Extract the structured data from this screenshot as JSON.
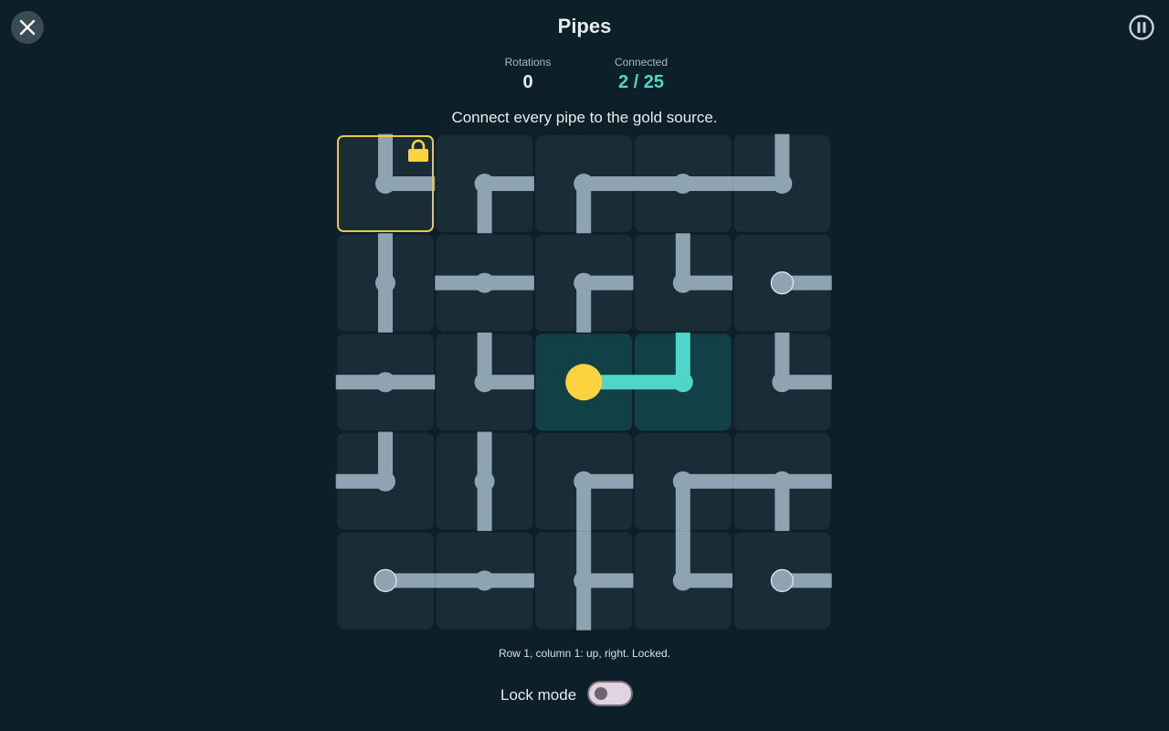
{
  "header": {
    "title": "Pipes",
    "close_icon": "close-icon",
    "pause_icon": "pause-icon"
  },
  "stats": {
    "rotations_label": "Rotations",
    "rotations_value": "0",
    "connected_label": "Connected",
    "connected_value": "2 / 25"
  },
  "instruction": "Connect every pipe to the gold source.",
  "grid": {
    "rows": 5,
    "cols": 5,
    "source": [
      2,
      2
    ],
    "selected": [
      0,
      0
    ],
    "locked": [
      [
        0,
        0
      ]
    ],
    "connected": [
      [
        2,
        2
      ],
      [
        2,
        3
      ]
    ],
    "tiles": [
      [
        [
          "up",
          "right"
        ],
        [
          "right",
          "down"
        ],
        [
          "right",
          "down"
        ],
        [
          "left",
          "right"
        ],
        [
          "up",
          "left"
        ]
      ],
      [
        [
          "up",
          "down"
        ],
        [
          "left",
          "right"
        ],
        [
          "right",
          "down"
        ],
        [
          "up",
          "right"
        ],
        [
          "right"
        ]
      ],
      [
        [
          "left",
          "right"
        ],
        [
          "up",
          "right"
        ],
        [
          "right"
        ],
        [
          "up",
          "left"
        ],
        [
          "up",
          "right"
        ]
      ],
      [
        [
          "up",
          "left"
        ],
        [
          "up",
          "down"
        ],
        [
          "right",
          "down"
        ],
        [
          "right",
          "down"
        ],
        [
          "left",
          "right",
          "down"
        ]
      ],
      [
        [
          "right"
        ],
        [
          "left",
          "right"
        ],
        [
          "up",
          "right",
          "down"
        ],
        [
          "up",
          "right"
        ],
        [
          "right"
        ]
      ]
    ]
  },
  "colors": {
    "background": "#0d1f29",
    "tile": "#1a2c36",
    "tile_connected": "#124047",
    "pipe": "#8ea4b2",
    "pipe_connected": "#4fd6c6",
    "source": "#fdd23f",
    "selection": "#e9c94a",
    "lock": "#fdd23f"
  },
  "status": "Row 1, column 1: up, right. Locked.",
  "lock_mode": {
    "label": "Lock mode",
    "enabled": false
  }
}
